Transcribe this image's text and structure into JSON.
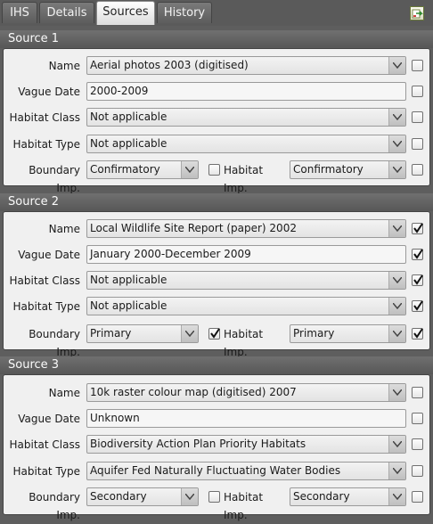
{
  "tabs": [
    {
      "label": "IHS",
      "active": false
    },
    {
      "label": "Details",
      "active": false
    },
    {
      "label": "Sources",
      "active": true
    },
    {
      "label": "History",
      "active": false
    }
  ],
  "labels": {
    "name": "Name",
    "vague_date": "Vague Date",
    "habitat_class": "Habitat Class",
    "habitat_type": "Habitat Type",
    "boundary_imp": "Boundary Imp.",
    "habitat_imp": "Habitat Imp."
  },
  "sources": [
    {
      "title": "Source 1",
      "name": "Aerial photos 2003 (digitised)",
      "vague_date": "2000-2009",
      "habitat_class": "Not applicable",
      "habitat_type": "Not applicable",
      "boundary_imp": "Confirmatory",
      "habitat_imp": "Confirmatory",
      "checks": {
        "name": false,
        "vague_date": false,
        "habitat_class": false,
        "habitat_type": false,
        "boundary_imp": false,
        "habitat_imp": false
      }
    },
    {
      "title": "Source 2",
      "name": "Local Wildlife Site Report (paper) 2002",
      "vague_date": "January 2000-December 2009",
      "habitat_class": "Not applicable",
      "habitat_type": "Not applicable",
      "boundary_imp": "Primary",
      "habitat_imp": "Primary",
      "checks": {
        "name": true,
        "vague_date": true,
        "habitat_class": true,
        "habitat_type": true,
        "boundary_imp": true,
        "habitat_imp": true
      }
    },
    {
      "title": "Source 3",
      "name": "10k raster colour map (digitised) 2007",
      "vague_date": "Unknown",
      "habitat_class": "Biodiversity Action Plan Priority Habitats",
      "habitat_type": "Aquifer Fed Naturally Fluctuating Water Bodies",
      "boundary_imp": "Secondary",
      "habitat_imp": "Secondary",
      "checks": {
        "name": false,
        "vague_date": false,
        "habitat_class": false,
        "habitat_type": false,
        "boundary_imp": false,
        "habitat_imp": false
      }
    }
  ]
}
